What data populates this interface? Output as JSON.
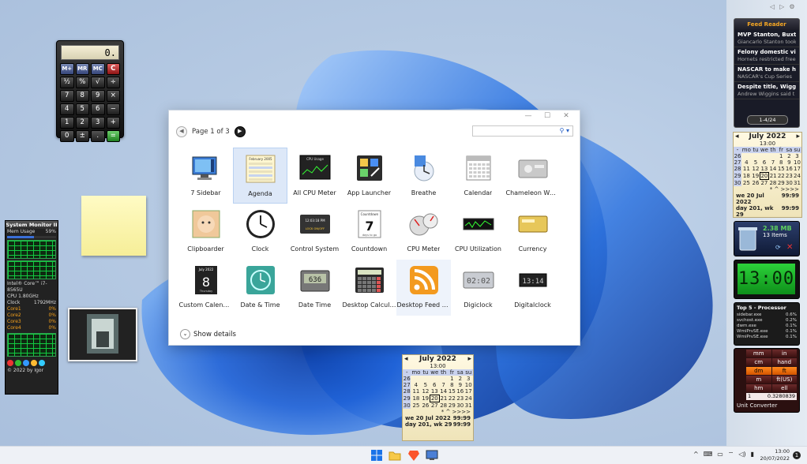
{
  "calculator": {
    "display": "0.",
    "keys": [
      "M+",
      "MR",
      "MC",
      "C",
      "½",
      "%",
      "√",
      "÷",
      "7",
      "8",
      "9",
      "×",
      "4",
      "5",
      "6",
      "−",
      "1",
      "2",
      "3",
      "+",
      "0",
      "±",
      ".",
      "="
    ]
  },
  "system_monitor": {
    "title": "System Monitor II",
    "mem_label": "Mem Usage",
    "mem_pct": "59%",
    "cpu_name": "Intel® Core™ i7-8565U",
    "cpu_speed": "CPU 1.80GHz",
    "clock_label": "Clock",
    "clock_val": "1792MHz",
    "cores": [
      "Core1",
      "Core2",
      "Core3",
      "Core4"
    ],
    "core_vals": [
      "0%",
      "0%",
      "0%",
      "0%"
    ],
    "footer": "© 2022 by Igor"
  },
  "window": {
    "page_text": "Page 1 of 3",
    "show_details": "Show details",
    "items": [
      {
        "label": "7 Sidebar",
        "icon": "sidebar-icon"
      },
      {
        "label": "Agenda",
        "icon": "agenda-icon"
      },
      {
        "label": "All CPU Meter",
        "icon": "cpu-meter-icon"
      },
      {
        "label": "App Launcher",
        "icon": "app-launcher-icon"
      },
      {
        "label": "Breathe",
        "icon": "breathe-icon"
      },
      {
        "label": "Calendar",
        "icon": "calendar-icon"
      },
      {
        "label": "Chameleon Wea...",
        "icon": "chameleon-weather-icon"
      },
      {
        "label": "Clipboarder",
        "icon": "clipboarder-icon"
      },
      {
        "label": "Clock",
        "icon": "clock-icon"
      },
      {
        "label": "Control System",
        "icon": "control-system-icon"
      },
      {
        "label": "Countdown",
        "icon": "countdown-icon"
      },
      {
        "label": "CPU Meter",
        "icon": "cpu-gauge-icon"
      },
      {
        "label": "CPU Utilization",
        "icon": "cpu-utilization-icon"
      },
      {
        "label": "Currency",
        "icon": "currency-icon"
      },
      {
        "label": "Custom Calendar",
        "icon": "custom-calendar-icon"
      },
      {
        "label": "Date & Time",
        "icon": "date-time-icon"
      },
      {
        "label": "Date Time",
        "icon": "date-time-lcd-icon"
      },
      {
        "label": "Desktop Calcula...",
        "icon": "desktop-calculator-icon"
      },
      {
        "label": "Desktop Feed R...",
        "icon": "rss-feed-icon"
      },
      {
        "label": "Digiclock",
        "icon": "digiclock-icon"
      },
      {
        "label": "Digitalclock",
        "icon": "digitalclock-icon"
      }
    ],
    "icon_text": {
      "agenda_title": "February 2005",
      "cpu_usage_title": "CPU Usage",
      "countdown_title": "Countdown",
      "countdown_days": "7",
      "countdown_sub": "days to go",
      "custom_cal_month": "July 2022",
      "custom_cal_day": "8",
      "custom_cal_weekday": "Thursday",
      "control_time": "12:03:18 PM",
      "control_lock": "LOCK ON/OFF",
      "digiclock_time": "02:02",
      "digitalclock_time": "13:14",
      "date_time_lcd": "636"
    }
  },
  "sidebar": {
    "feed": {
      "title": "Feed Reader",
      "items": [
        {
          "headline": "MVP Stanton, Buxtor",
          "sub": "Giancarlo Stanton took"
        },
        {
          "headline": "Felony domestic vic",
          "sub": "Hornets restricted free"
        },
        {
          "headline": "NASCAR to make his",
          "sub": "NASCAR's Cup Series"
        },
        {
          "headline": "Despite title, Wiggin",
          "sub": "Andrew Wiggins said t"
        }
      ],
      "page": "1-4/24"
    },
    "calendar": {
      "month": "July 2022",
      "time": "13:00",
      "days": [
        "mo",
        "tu",
        "we",
        "th",
        "fr",
        "sa",
        "su"
      ],
      "weeks": [
        {
          "wk": "26",
          "d": [
            "",
            "",
            "",
            "",
            "1",
            "2",
            "3"
          ]
        },
        {
          "wk": "27",
          "d": [
            "4",
            "5",
            "6",
            "7",
            "8",
            "9",
            "10"
          ]
        },
        {
          "wk": "28",
          "d": [
            "11",
            "12",
            "13",
            "14",
            "15",
            "16",
            "17"
          ]
        },
        {
          "wk": "29",
          "d": [
            "18",
            "19",
            "20",
            "21",
            "22",
            "23",
            "24"
          ]
        },
        {
          "wk": "30",
          "d": [
            "25",
            "26",
            "27",
            "28",
            "29",
            "30",
            "31"
          ]
        }
      ],
      "nav": "* ^ >>>>",
      "foot1_l": "we 20 Jul 2022",
      "foot1_r": "99:99",
      "foot2_l": "day 201, wk 29",
      "foot2_r": "99:99"
    },
    "recycle": {
      "size": "2.38 MB",
      "items": "13 Items"
    },
    "clock": "13:00",
    "top5": {
      "title": "Top 5 - Processor",
      "rows": [
        {
          "n": "sidebar.exe",
          "v": "0.6%"
        },
        {
          "n": "svchost.exe",
          "v": "0.2%"
        },
        {
          "n": "dwm.exe",
          "v": "0.1%"
        },
        {
          "n": "WmiPrvSE.exe",
          "v": "0.1%"
        },
        {
          "n": "WmiPrvSE.exe",
          "v": "0.1%"
        }
      ]
    },
    "unit": {
      "buttons": [
        "mm",
        "in",
        "cm",
        "hand",
        "dm",
        "ft",
        "m",
        "ft(US)",
        "hm",
        "ell"
      ],
      "value_l": "1",
      "value_r": "0.3280839",
      "footer": "Unit Converter"
    }
  },
  "taskbar": {
    "time": "13:00",
    "date": "20/07/2022",
    "tray": [
      "^",
      "⌨",
      "▭",
      "⌔",
      "◁)",
      "▮"
    ],
    "notif": "1"
  }
}
